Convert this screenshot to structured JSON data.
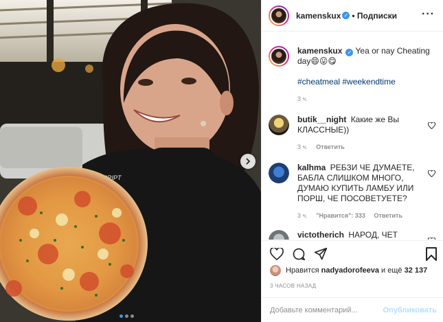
{
  "post": {
    "username": "kamenskux",
    "follow_label": "• Подписки",
    "caption_username": "kamenskux",
    "caption_text": "Yea or nay Cheating day😄😛😋",
    "caption_hashtags": "#cheatmeal #weekendtime",
    "caption_time": "3 ч."
  },
  "comments": [
    {
      "username": "butik__night",
      "text": "Какие же Вы КЛАССНЫЕ))",
      "time": "3 ч.",
      "reply_label": "Ответить"
    },
    {
      "username": "kalhma",
      "text": "РЕБЗИ ЧЕ ДУМАЕТЕ, БАБЛА СЛИШКОМ МНОГО, ДУМАЮ КУПИТЬ ЛАМБУ ИЛИ ПОРШ, ЧЕ ПОСОВЕТУЕТЕ?",
      "time": "3 ч.",
      "likes_label": "\"Нравится\": 333",
      "reply_label": "Ответить"
    },
    {
      "username": "victotherich",
      "text": "НАРОД, ЧЕТ"
    }
  ],
  "likes_line": {
    "prefix": "Нравится",
    "user": "nadyadorofeeva",
    "middle": "и ещё",
    "count": "32 137"
  },
  "timestamp": "3 ЧАСОВ НАЗАД",
  "comment_input": {
    "placeholder": "Добавьте комментарий...",
    "publish_label": "Опубликовать"
  },
  "icons": [
    "heart-icon",
    "comment-icon",
    "share-icon",
    "bookmark-icon",
    "more-options-icon",
    "next-arrow-icon",
    "verified-badge-icon"
  ],
  "colors": {
    "accent_blue": "#3897f0",
    "hashtag": "#00376b",
    "muted": "#8e8e8e",
    "publish_disabled": "#b2dffc"
  }
}
